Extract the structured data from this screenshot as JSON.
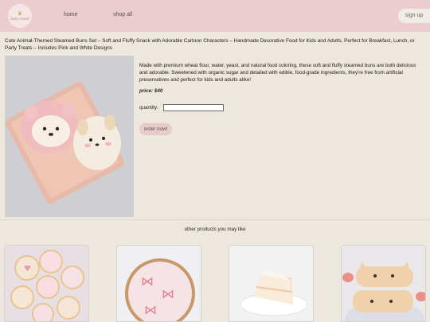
{
  "header": {
    "logo_text": "baby mood",
    "nav": {
      "home": "home",
      "shop_all": "shop all"
    },
    "signup_label": "sign up"
  },
  "product": {
    "title": "Cute Animal-Themed Steamed Buns Set – Soft and Fluffy Snack with Adorable Cartoon Characters – Handmade Decorative Food for Kids and Adults, Perfect for Breakfast, Lunch, or Party Treats – Includes Pink and White Designs",
    "description": "Made with premium wheat flour, water, yeast, and natural food coloring, these soft and fluffy steamed buns are both delicious and adorable. Sweetened with organic sugar and detailed with edible, food-grade ingredients, they're free from artificial preservatives and perfect for kids and adults alike!",
    "price": "price: $40",
    "quantity_label": "quantity:",
    "quantity_value": "",
    "order_button": "order now!"
  },
  "recommendations": {
    "heading": "other products you may like",
    "items": [
      {
        "icon": "iced-cookies-image"
      },
      {
        "icon": "bow-cookie-image"
      },
      {
        "icon": "cake-slice-image"
      },
      {
        "icon": "cat-toast-image"
      }
    ]
  },
  "colors": {
    "header_bg": "#ebcdd0",
    "page_bg": "#ede8dd",
    "button_bg": "#e8cccd"
  }
}
